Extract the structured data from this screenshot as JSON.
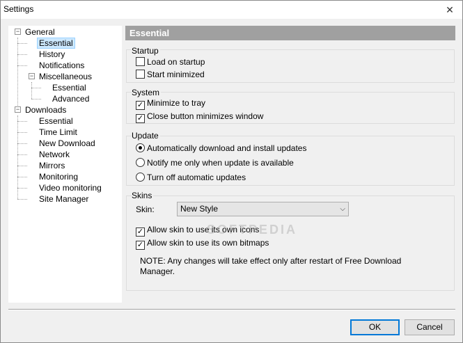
{
  "window": {
    "title": "Settings",
    "close_glyph": "✕"
  },
  "tree": {
    "items": [
      {
        "label": "General",
        "expander": "−"
      },
      {
        "label": "Essential"
      },
      {
        "label": "History"
      },
      {
        "label": "Notifications"
      },
      {
        "label": "Miscellaneous",
        "expander": "−"
      },
      {
        "label": "Essential"
      },
      {
        "label": "Advanced"
      },
      {
        "label": "Downloads",
        "expander": "−"
      },
      {
        "label": "Essential"
      },
      {
        "label": "Time Limit"
      },
      {
        "label": "New Download"
      },
      {
        "label": "Network"
      },
      {
        "label": "Mirrors"
      },
      {
        "label": "Monitoring"
      },
      {
        "label": "Video monitoring"
      },
      {
        "label": "Site Manager"
      }
    ],
    "selected": "Essential"
  },
  "content": {
    "header": "Essential",
    "startup": {
      "title": "Startup",
      "load_on_startup": {
        "label": "Load on startup",
        "checked": false
      },
      "start_minimized": {
        "label": "Start minimized",
        "checked": false
      }
    },
    "system": {
      "title": "System",
      "minimize_to_tray": {
        "label": "Minimize to tray",
        "checked": true,
        "mark": "✓"
      },
      "close_minimizes": {
        "label": "Close button minimizes window",
        "checked": true,
        "mark": "✓"
      }
    },
    "update": {
      "title": "Update",
      "options": [
        {
          "label": "Automatically download and install updates",
          "selected": true
        },
        {
          "label": "Notify me only when update is available",
          "selected": false
        },
        {
          "label": "Turn off automatic updates",
          "selected": false
        }
      ]
    },
    "skins": {
      "title": "Skins",
      "skin_label": "Skin:",
      "skin_value": "New Style",
      "allow_icons": {
        "label": "Allow skin to use its own icons",
        "checked": true,
        "mark": "✓"
      },
      "allow_bitmaps": {
        "label": "Allow skin to use its own bitmaps",
        "checked": true,
        "mark": "✓"
      },
      "note_line1": "NOTE: Any changes will take effect only after restart of Free Download",
      "note_line2": "Manager."
    }
  },
  "buttons": {
    "ok": "OK",
    "cancel": "Cancel"
  },
  "watermark": "SOFTPEDIA"
}
